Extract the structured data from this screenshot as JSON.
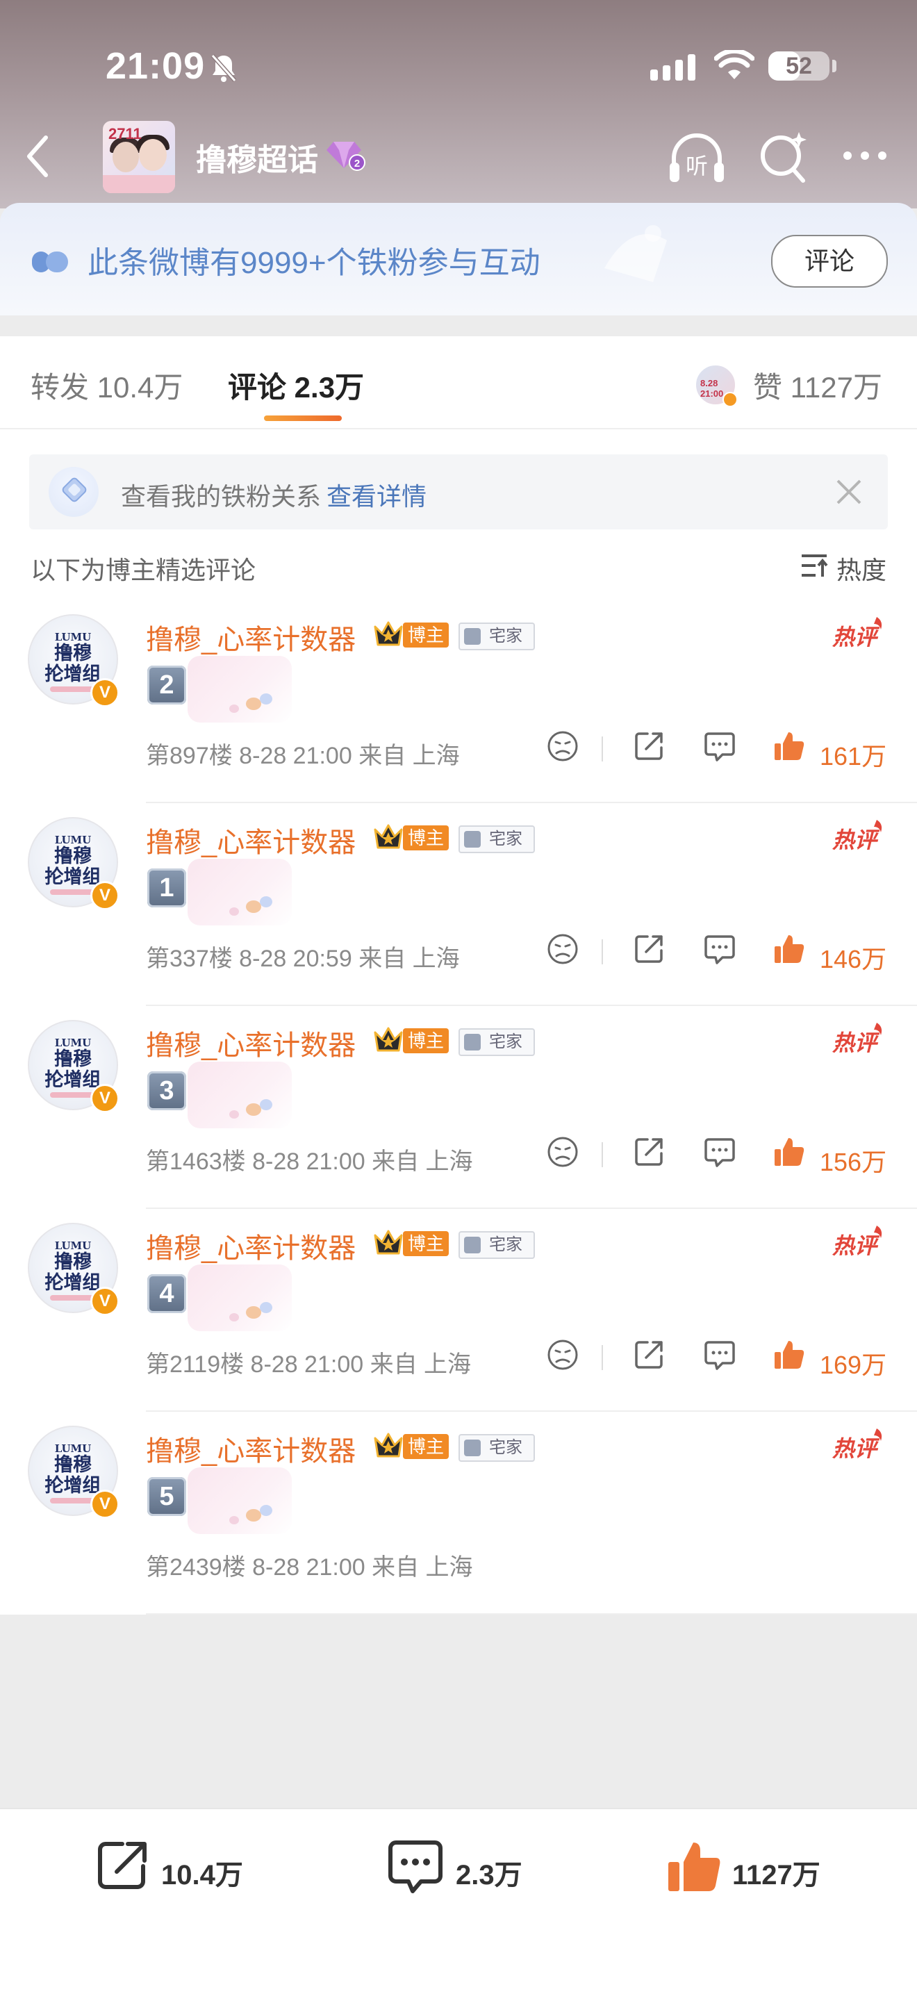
{
  "status_bar": {
    "time": "21:09",
    "battery": "52"
  },
  "header": {
    "group_title": "撸穆超话",
    "avatar_tag": "2711"
  },
  "fans_banner": {
    "text": "此条微博有9999+个铁粉参与互动",
    "button": "评论"
  },
  "tabs": {
    "repost": "转发 10.4万",
    "comment": "评论 2.3万",
    "like": "赞 1127万",
    "like_avatar_text": "8.28 21:00"
  },
  "ironfan": {
    "label": "查看我的铁粉关系",
    "link": "查看详情"
  },
  "filter": {
    "label": "以下为博主精选评论",
    "sort": "热度"
  },
  "avatar": {
    "brand": "LUMU",
    "line1": "撸穆",
    "line2": "抡增组",
    "verified": "V"
  },
  "badges": {
    "host": "博主",
    "home": "宅家"
  },
  "comments": [
    {
      "name": "撸穆_心率计数器",
      "rank": "2",
      "meta": "第897楼 8-28 21:00 来自 上海",
      "likes": "161万",
      "has_actions": true
    },
    {
      "name": "撸穆_心率计数器",
      "rank": "1",
      "meta": "第337楼 8-28 20:59 来自 上海",
      "likes": "146万",
      "has_actions": true
    },
    {
      "name": "撸穆_心率计数器",
      "rank": "3",
      "meta": "第1463楼 8-28 21:00 来自 上海",
      "likes": "156万",
      "has_actions": true
    },
    {
      "name": "撸穆_心率计数器",
      "rank": "4",
      "meta": "第2119楼 8-28 21:00 来自 上海",
      "likes": "169万",
      "has_actions": true
    },
    {
      "name": "撸穆_心率计数器",
      "rank": "5",
      "meta": "第2439楼 8-28 21:00 来自 上海",
      "likes": "",
      "has_actions": false
    }
  ],
  "bottom_bar": {
    "repost": "10.4万",
    "comment": "2.3万",
    "like": "1127万"
  },
  "colors": {
    "accent_orange": "#e8702b",
    "link_blue": "#4a76b9",
    "banner_blue": "#5b86c8"
  },
  "icons": [
    "back-icon",
    "gem-level-icon",
    "listen-icon",
    "chaohua-search-icon",
    "more-icon",
    "fans-icon",
    "close-icon",
    "sort-icon",
    "crown-icon",
    "hot-comment-icon",
    "dislike-icon",
    "share-icon",
    "reply-icon",
    "like-icon",
    "repost-icon",
    "comment-icon"
  ]
}
